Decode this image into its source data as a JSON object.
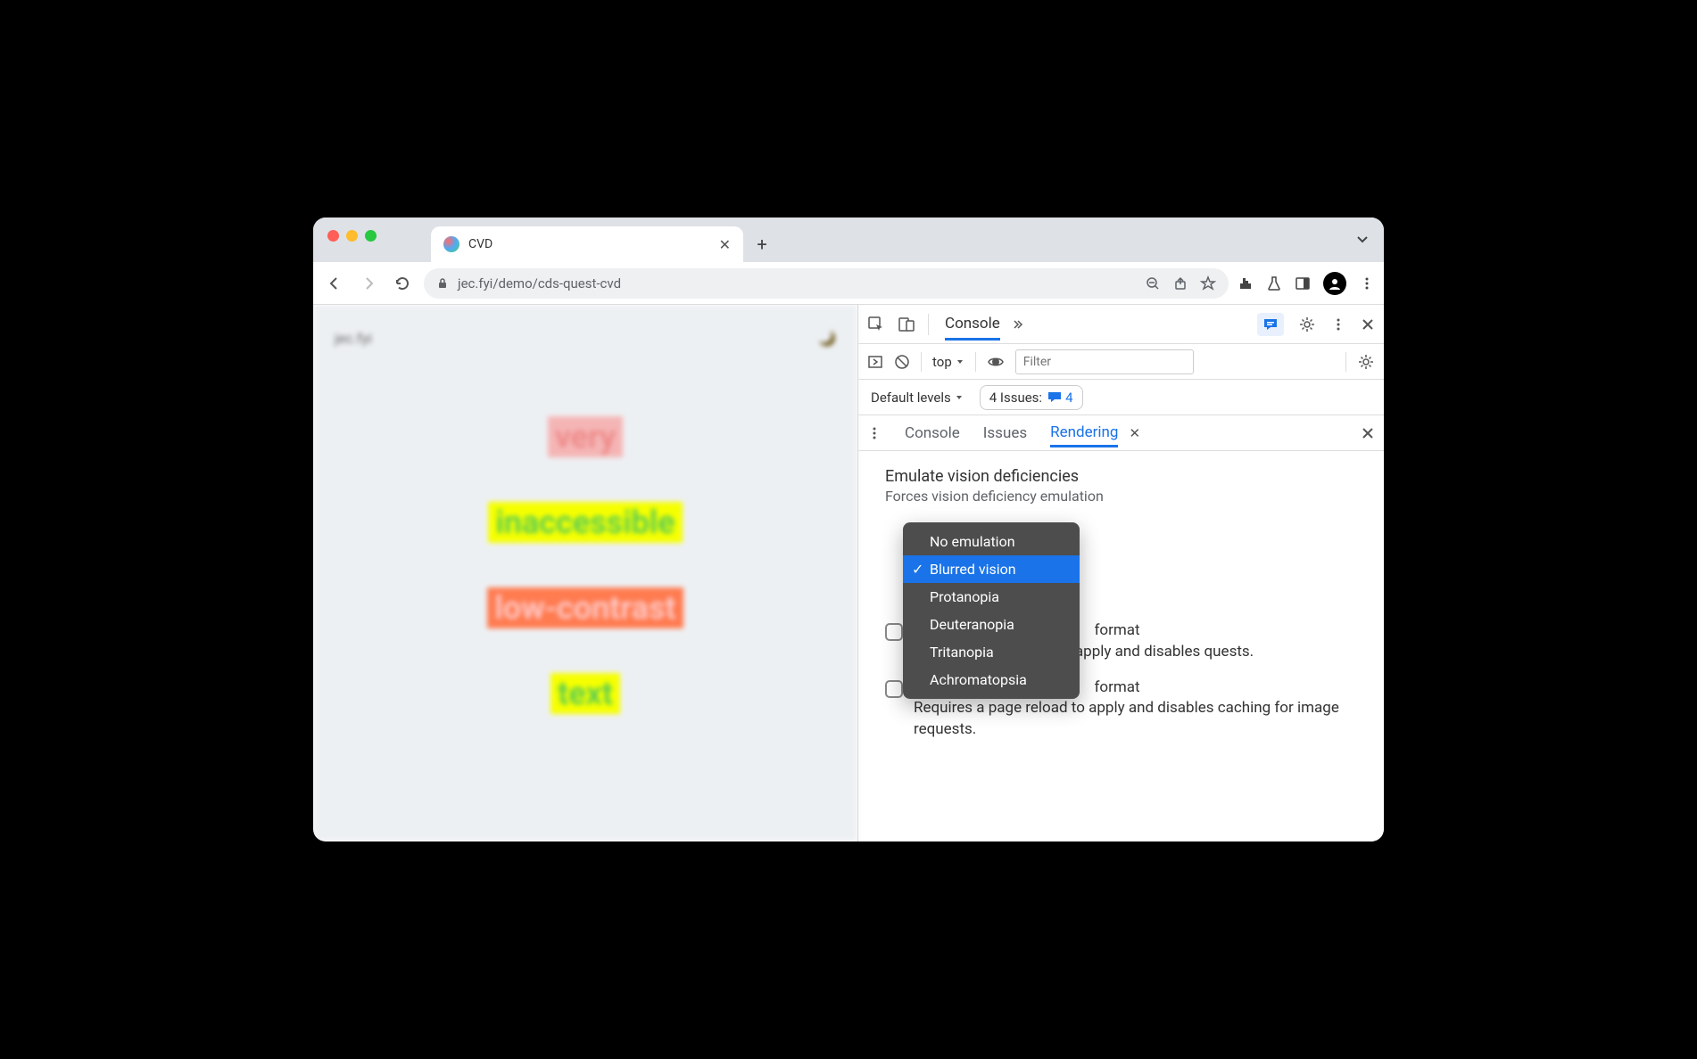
{
  "tab": {
    "title": "CVD"
  },
  "url": {
    "host": "jec.fyi",
    "path": "/demo/cds-quest-cvd"
  },
  "page": {
    "site_label": "jec.fyi",
    "theme_icon": "🌙",
    "words": [
      "very",
      "inaccessible",
      "low-contrast",
      "text"
    ]
  },
  "devtools": {
    "panel": "Console",
    "context": "top",
    "filter_placeholder": "Filter",
    "levels": "Default levels",
    "issues_label": "4 Issues:",
    "issues_count": "4",
    "drawer_tabs": [
      "Console",
      "Issues",
      "Rendering"
    ],
    "rendering": {
      "title": "Emulate vision deficiencies",
      "desc": "Forces vision deficiency emulation",
      "options": [
        "No emulation",
        "Blurred vision",
        "Protanopia",
        "Deuteranopia",
        "Tritanopia",
        "Achromatopsia"
      ],
      "section2_title_suffix": "format",
      "section2_text": "ad to apply and disables quests.",
      "section3_title_suffix": "format",
      "section3_text": "Requires a page reload to apply and disables caching for image requests."
    }
  }
}
